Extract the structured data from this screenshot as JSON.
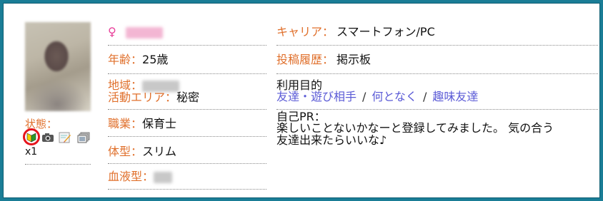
{
  "profile": {
    "gender_symbol": "♀",
    "age_label": "年齢：",
    "age_value": "25歳",
    "region_label": "地域：",
    "activity_label": "活動エリア：",
    "activity_value": "秘密",
    "job_label": "職業：",
    "job_value": "保育士",
    "body_label": "体型：",
    "body_value": "スリム",
    "blood_label": "血液型：",
    "status_label": "状態：",
    "status_count": "x1"
  },
  "right": {
    "carrier_label": "キャリア：",
    "carrier_value": "スマートフォン/PC",
    "history_label": "投稿履歴：",
    "history_value": "掲示板",
    "purpose_label": "利用目的",
    "purposes": [
      "友達・遊び相手",
      "何となく",
      "趣味友達"
    ],
    "slash": "/",
    "pr_label": "自己PR：",
    "pr_line1": "楽しいことないかなーと登録してみました。 気の合う",
    "pr_line2": "友達出来たらいいな♪"
  },
  "colors": {
    "frame": "#1a7d96",
    "label": "#e0702c",
    "link": "#5a5ad6",
    "highlight_ring": "#e5141c"
  },
  "icons": [
    "beginner-mark-icon",
    "camera-icon",
    "edit-icon",
    "photos-icon"
  ]
}
